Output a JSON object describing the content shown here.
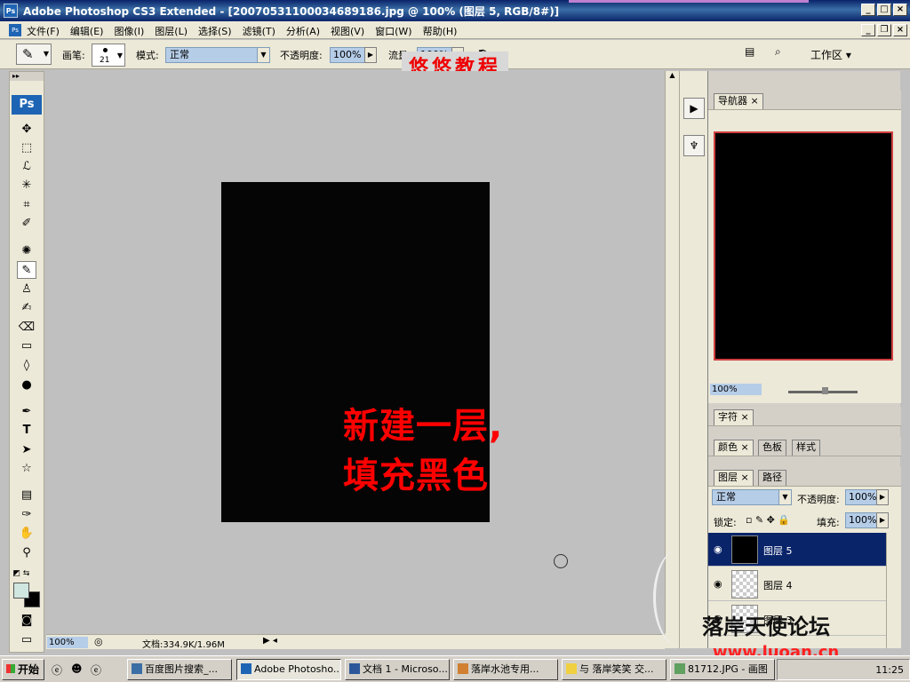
{
  "window": {
    "title": "Adobe Photoshop CS3 Extended - [20070531100034689186.jpg @ 100% (图层 5, RGB/8#)]"
  },
  "menu": [
    "文件(F)",
    "编辑(E)",
    "图像(I)",
    "图层(L)",
    "选择(S)",
    "滤镜(T)",
    "分析(A)",
    "视图(V)",
    "窗口(W)",
    "帮助(H)"
  ],
  "options": {
    "brush_label": "画笔:",
    "brush_size": "21",
    "mode_label": "模式:",
    "mode_value": "正常",
    "opacity_label": "不透明度:",
    "opacity_value": "100%",
    "flow_label": "流量:",
    "flow_value": "100%",
    "workspace_label": "工作区 ▾"
  },
  "watermark_top": "悠悠教程",
  "canvas": {
    "annotation_line1": "新建一层,",
    "annotation_line2": "填充黑色"
  },
  "status": {
    "zoom": "100%",
    "doc_info": "文档:334.9K/1.96M"
  },
  "navigator": {
    "tab": "导航器",
    "zoom": "100%"
  },
  "character_panel": {
    "tab": "字符"
  },
  "color_panel": {
    "tabs": [
      "颜色",
      "色板",
      "样式"
    ]
  },
  "layers_panel": {
    "tabs": [
      "图层",
      "路径"
    ],
    "blend_mode": "正常",
    "opacity_label": "不透明度:",
    "opacity_value": "100%",
    "lock_label": "锁定:",
    "fill_label": "填充:",
    "fill_value": "100%",
    "layers": [
      {
        "name": "图层 5",
        "selected": true,
        "thumb": "black"
      },
      {
        "name": "图层 4",
        "selected": false,
        "thumb": "transparent"
      },
      {
        "name": "图层 3",
        "selected": false,
        "thumb": "transparent"
      }
    ]
  },
  "bottom_watermark": {
    "logo_text": "落岸天使论坛",
    "url": "www.luoan.cn"
  },
  "taskbar": {
    "start_label": "开始",
    "buttons": [
      {
        "label": "百度图片搜索_...",
        "active": false
      },
      {
        "label": "Adobe Photosho...",
        "active": true
      },
      {
        "label": "文档 1 - Microso...",
        "active": false
      },
      {
        "label": "落岸水池专用...",
        "active": false
      },
      {
        "label": "与 落岸笑笑 交...",
        "active": false
      },
      {
        "label": "81712.JPG - 画图",
        "active": false
      }
    ],
    "time": "11:25"
  },
  "colors": {
    "titlebar": "#0a246a",
    "annotation": "#ff0000",
    "canvas_fill": "#050505",
    "selected_layer": "#0a246a"
  }
}
